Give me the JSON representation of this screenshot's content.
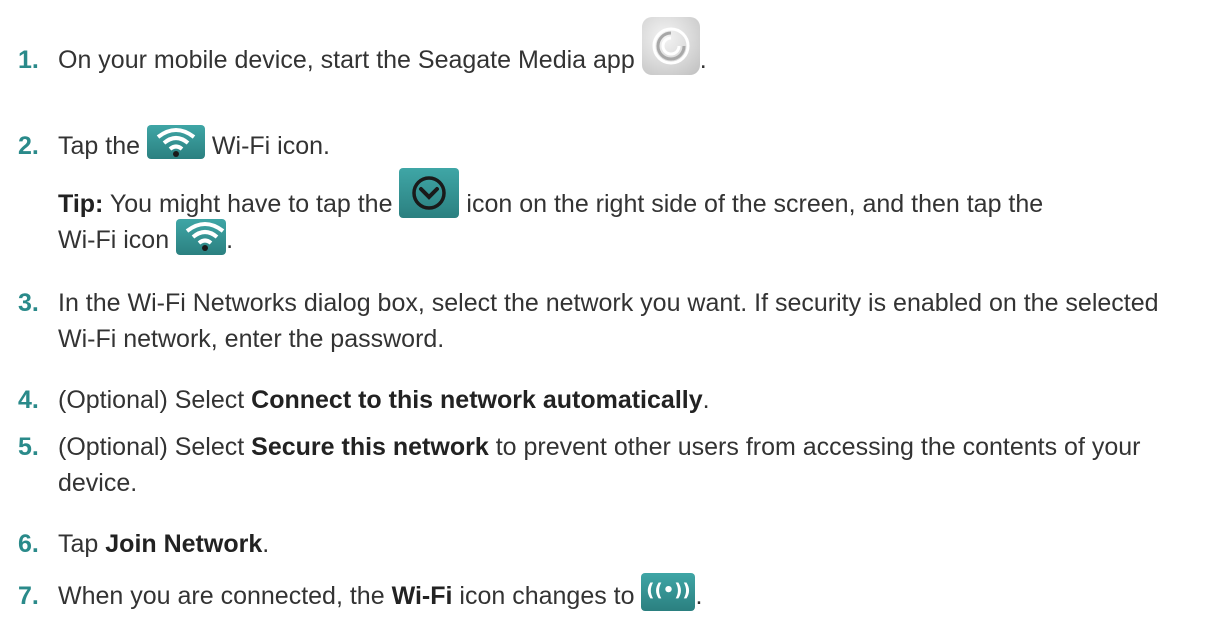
{
  "steps": [
    {
      "number": "1.",
      "text_a": "On your mobile device, start the Seagate Media app",
      "text_b": ".",
      "icon": "seagate-media-app-icon"
    },
    {
      "number": "2.",
      "text_a": "Tap the",
      "text_b": "Wi-Fi icon.",
      "icon": "wifi-icon"
    },
    {
      "number": "3.",
      "text": "In the Wi-Fi Networks dialog box, select the network you want. If security is enabled on the selected Wi-Fi network, enter the password."
    },
    {
      "number": "4.",
      "text_a": "(Optional) Select",
      "bold": "Connect to this network automatically",
      "text_b": "."
    },
    {
      "number": "5.",
      "text_a": "(Optional) Select",
      "bold": "Secure this network",
      "text_b": "to prevent other users from accessing the contents of your device."
    },
    {
      "number": "6.",
      "text_a": "Tap",
      "bold": "Join Network",
      "text_b": "."
    },
    {
      "number": "7.",
      "text_a": "When you are connected, the",
      "bold": "Wi-Fi",
      "text_b": "icon changes to",
      "text_c": ".",
      "icon_text": "((•))"
    }
  ],
  "tip": {
    "label": "Tip:",
    "text_a": "You might have to tap the",
    "text_b": "icon on the right side of the screen, and then tap the",
    "text_c": "Wi-Fi icon",
    "text_d": "."
  },
  "colors": {
    "number": "#2a8a8a",
    "icon_teal": "#3fa6a6",
    "body_text": "#333333"
  }
}
